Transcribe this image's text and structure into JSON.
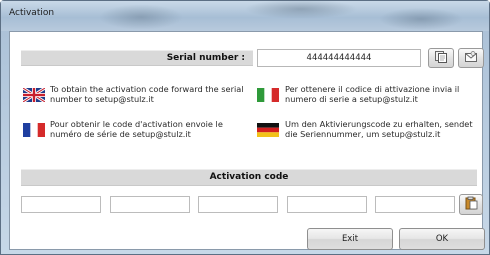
{
  "window": {
    "title": "Activation"
  },
  "serial": {
    "label": "Serial number :",
    "value": "444444444444"
  },
  "notes": {
    "english": "To obtain the activation code forward the serial number to setup@stulz.it",
    "italian": "Per ottenere il codice di attivazione invia il numero di serie a setup@stulz.it",
    "french": "Pour obtenir le code d'activation envoie le numéro de série de setup@stulz.it",
    "german": "Um den Aktivierungscode zu erhalten, sendet die Seriennummer, um setup@stulz.it"
  },
  "activation": {
    "label": "Activation code",
    "fields": [
      "",
      "",
      "",
      "",
      ""
    ]
  },
  "buttons": {
    "exit_label": "Exit",
    "ok_label": "OK"
  },
  "icons": {
    "copy_serial": "copy-icon",
    "send_serial": "envelope-icon",
    "paste_code": "paste-icon",
    "flag_uk": "uk-flag-icon",
    "flag_it": "italy-flag-icon",
    "flag_fr": "france-flag-icon",
    "flag_de": "germany-flag-icon"
  }
}
